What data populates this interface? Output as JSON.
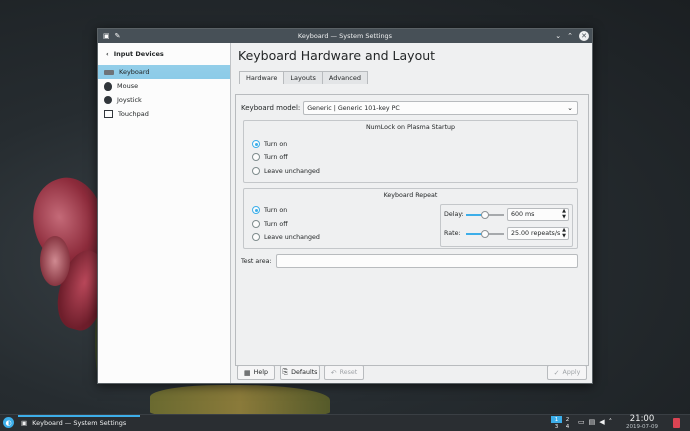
{
  "window": {
    "title": "Keyboard — System Settings"
  },
  "sidebar": {
    "back_label": "Input Devices",
    "items": [
      {
        "label": "Keyboard",
        "icon": "keyboard-icon"
      },
      {
        "label": "Mouse",
        "icon": "mouse-icon"
      },
      {
        "label": "Joystick",
        "icon": "joystick-icon"
      },
      {
        "label": "Touchpad",
        "icon": "touchpad-icon"
      }
    ],
    "selected": "Keyboard"
  },
  "page": {
    "title": "Keyboard Hardware and Layout",
    "tabs": [
      {
        "label": "Hardware",
        "active": true
      },
      {
        "label": "Layouts",
        "active": false
      },
      {
        "label": "Advanced",
        "active": false
      }
    ]
  },
  "hardware": {
    "model_label": "Keyboard model:",
    "model_value": "Generic | Generic 101-key PC",
    "numlock": {
      "title": "NumLock on Plasma Startup",
      "options": [
        "Turn on",
        "Turn off",
        "Leave unchanged"
      ],
      "selected": "Turn on"
    },
    "repeat": {
      "title": "Keyboard Repeat",
      "options": [
        "Turn on",
        "Turn off",
        "Leave unchanged"
      ],
      "selected": "Turn on",
      "delay_label": "Delay:",
      "delay_value": "600 ms",
      "delay_fraction": 0.5,
      "rate_label": "Rate:",
      "rate_value": "25.00 repeats/s",
      "rate_fraction": 0.5
    },
    "test_label": "Test area:",
    "test_value": ""
  },
  "buttons": {
    "help": "Help",
    "defaults": "Defaults",
    "reset": "Reset",
    "apply": "Apply"
  },
  "taskbar": {
    "task_label": "Keyboard — System Settings",
    "pager": [
      "1",
      "2",
      "3",
      "4"
    ],
    "time": "21:00",
    "date": "2019-07-09"
  },
  "colors": {
    "accent": "#3daee9",
    "titlebar": "#475057",
    "taskbar": "#2a2e32"
  }
}
